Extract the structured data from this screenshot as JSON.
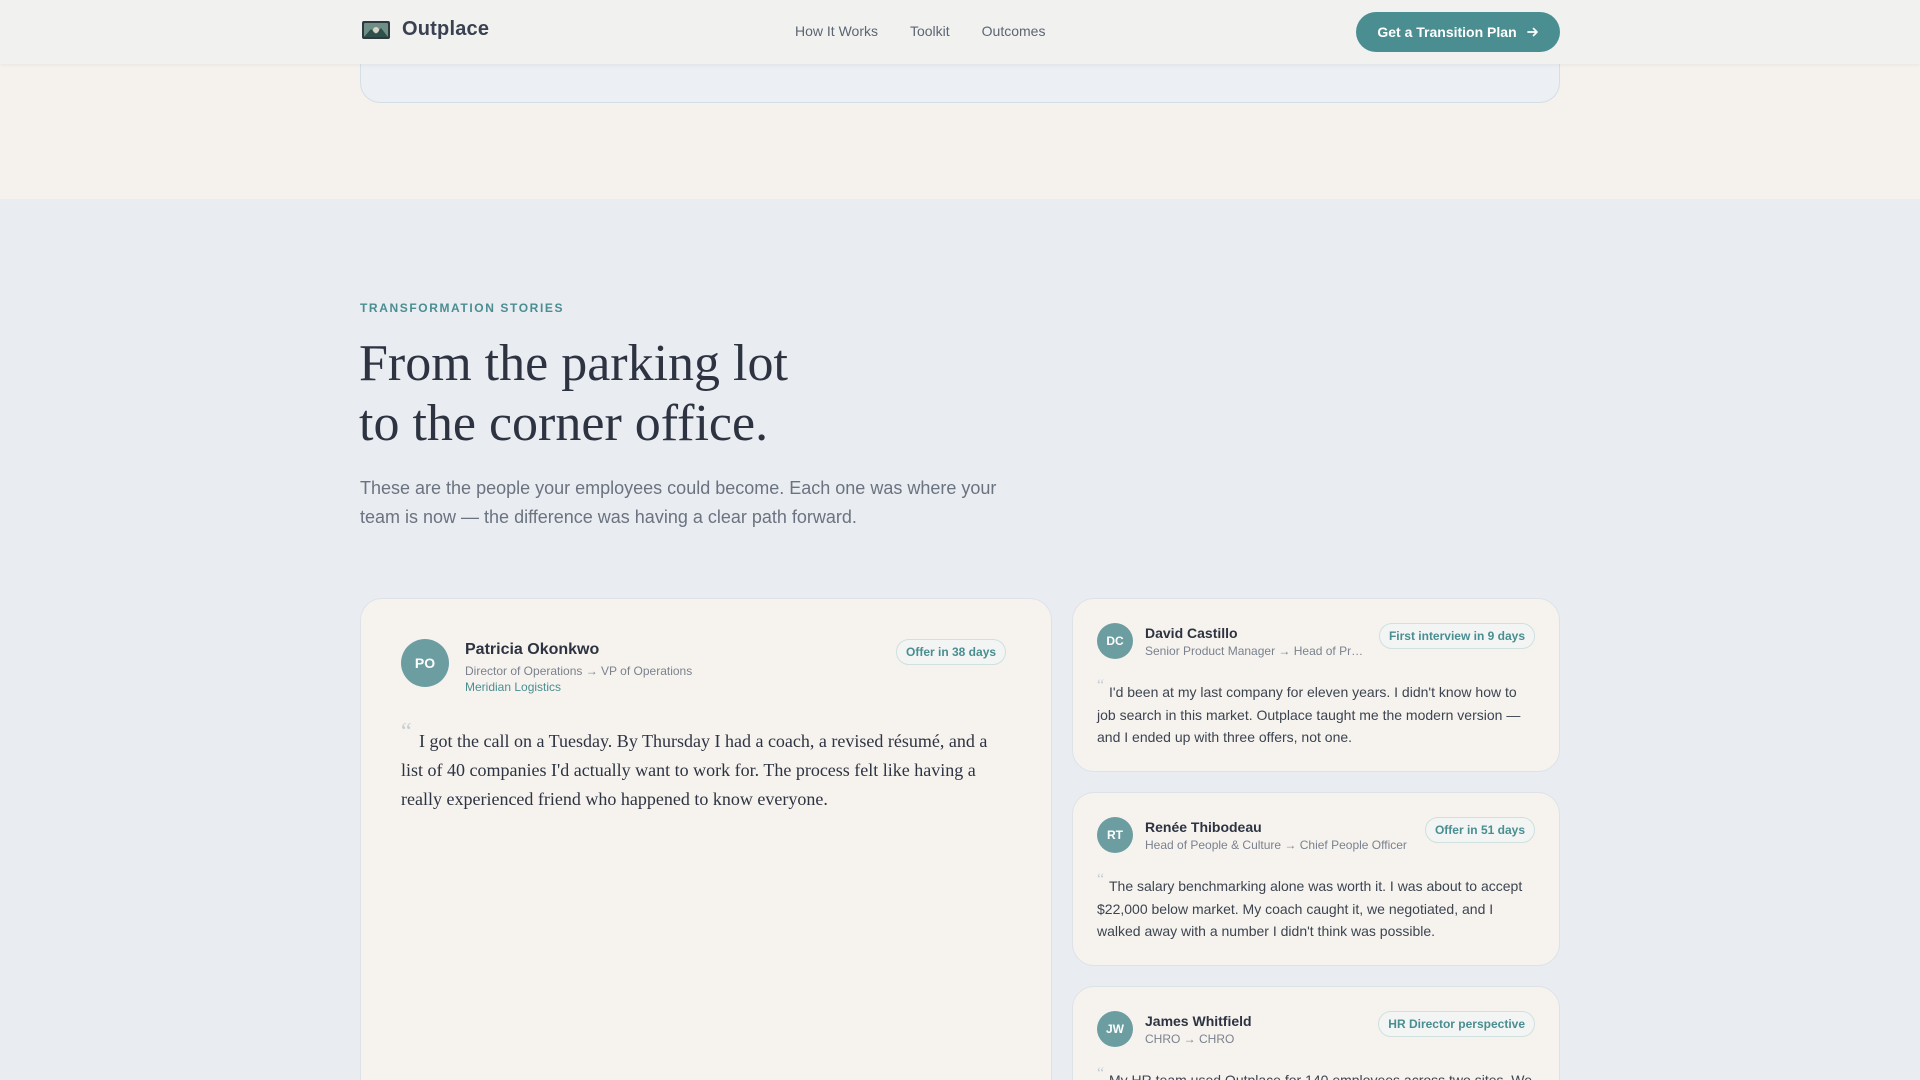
{
  "nav": {
    "brand": "Outplace",
    "links": [
      "How It Works",
      "Toolkit",
      "Outcomes"
    ],
    "cta": "Get a Transition Plan",
    "cta_icon": "arrow-right-icon"
  },
  "section": {
    "eyebrow": "TRANSFORMATION STORIES",
    "headline_line1": "From the parking lot",
    "headline_line2": "to the corner office.",
    "subtext": "These are the people your employees could become. Each one was where your team is now — the difference was having a clear path forward."
  },
  "stories": [
    {
      "initials": "PO",
      "name": "Patricia Okonkwo",
      "role": "Director of Operations → VP of Operations",
      "company": "Meridian Logistics",
      "badge": "Offer in 38 days",
      "quote": "I got the call on a Tuesday. By Thursday I had a coach, a revised résumé, and a list of 40 companies I'd actually want to work for. The process felt like having a really experienced friend who happened to know everyone."
    },
    {
      "initials": "DC",
      "name": "David Castillo",
      "role": "Senior Product Manager → Head of Pr…",
      "badge": "First interview in 9 days",
      "quote": "I'd been at my last company for eleven years. I didn't know how to job search in this market. Outplace taught me the modern version — and I ended up with three offers, not one."
    },
    {
      "initials": "RT",
      "name": "Renée Thibodeau",
      "role": "Head of People & Culture → Chief People Officer",
      "badge": "Offer in 51 days",
      "quote": "The salary benchmarking alone was worth it. I was about to accept $22,000 below market. My coach caught it, we negotiated, and I walked away with a number I didn't think was possible."
    },
    {
      "initials": "JW",
      "name": "James Whitfield",
      "role": "CHRO → CHRO",
      "badge": "HR Director perspective",
      "quote": "My HR team used Outplace for 140 employees across two sites. We"
    }
  ],
  "colors": {
    "accent": "#4a8e91",
    "avatar": "#6c9ea1",
    "background": "#e9ecf1",
    "card": "#f6f3ef"
  }
}
